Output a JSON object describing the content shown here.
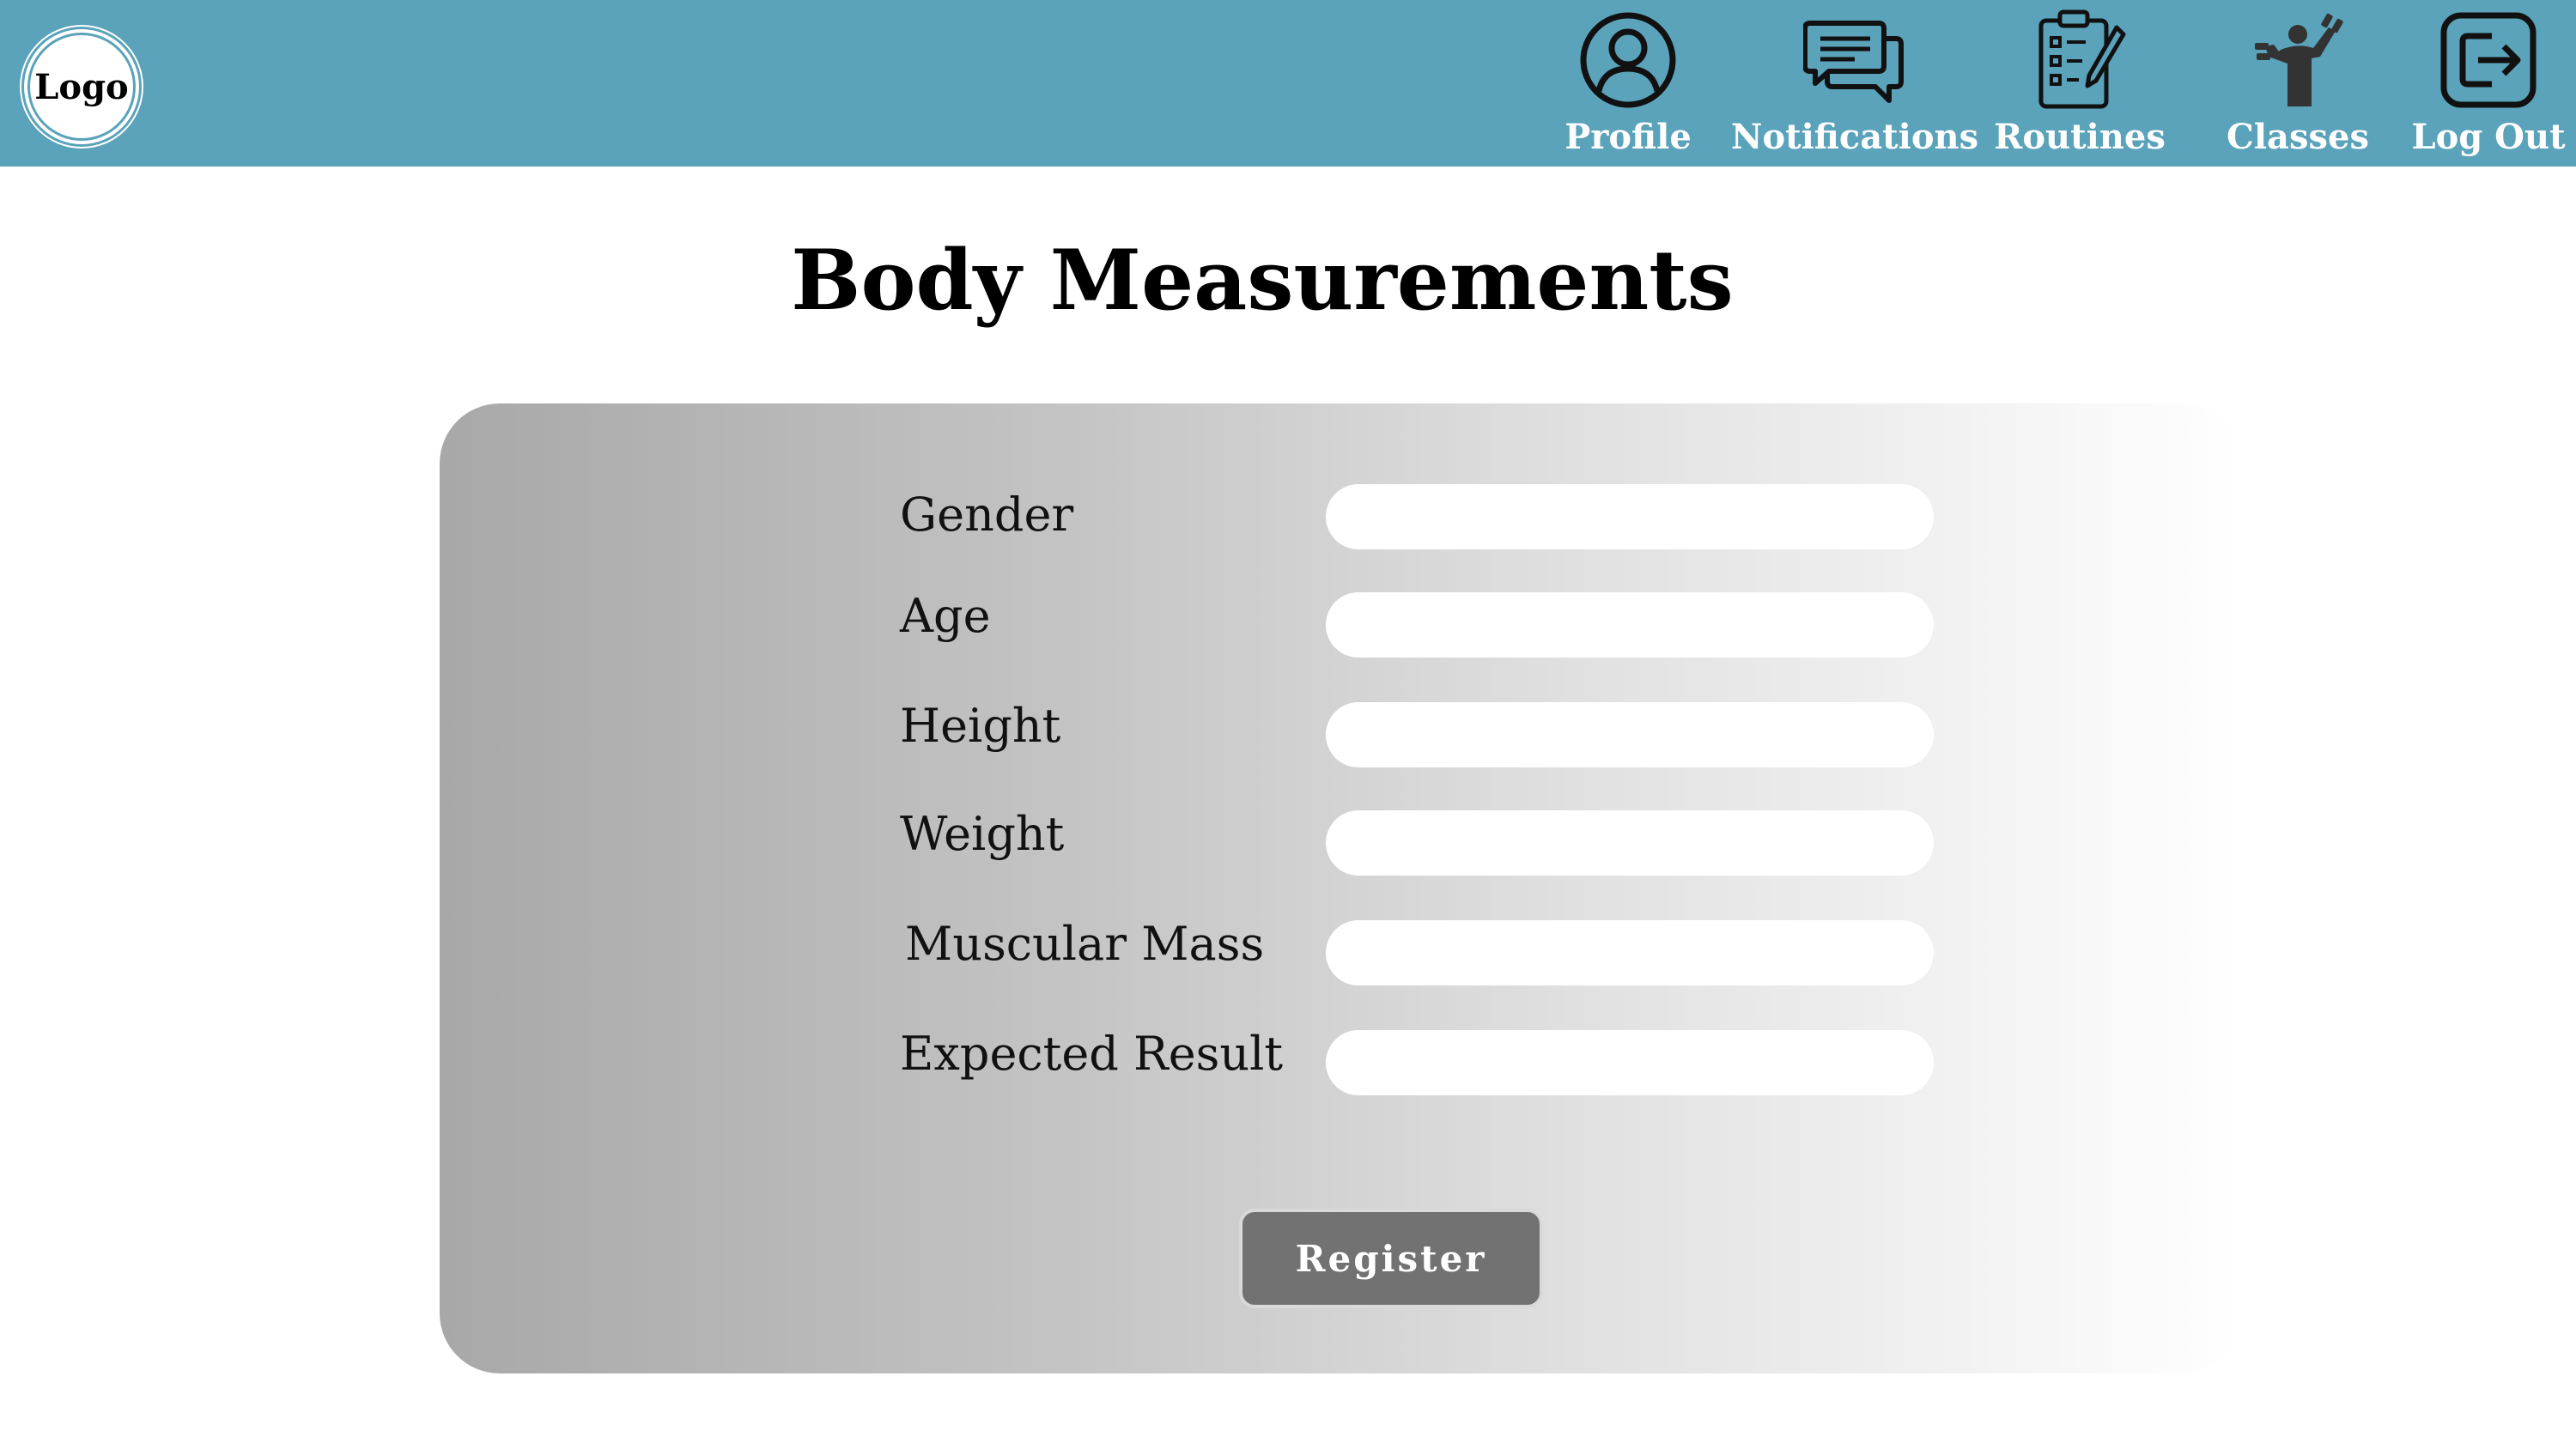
{
  "header": {
    "logo_text": "Logo",
    "bar_color": "#5aa3ba",
    "nav": [
      {
        "label": "Profile",
        "icon": "profile-icon"
      },
      {
        "label": "Notifications",
        "icon": "chat-bubbles-icon"
      },
      {
        "label": "Routines",
        "icon": "clipboard-checklist-icon"
      },
      {
        "label": "Classes",
        "icon": "weightlifter-icon"
      },
      {
        "label": "Log Out",
        "icon": "logout-icon"
      }
    ]
  },
  "main": {
    "title": "Body Measurements",
    "fields": [
      {
        "label": "Gender",
        "value": ""
      },
      {
        "label": "Age",
        "value": ""
      },
      {
        "label": "Height",
        "value": ""
      },
      {
        "label": "Weight",
        "value": ""
      },
      {
        "label": "Muscular Mass",
        "value": ""
      },
      {
        "label": "Expected Result",
        "value": ""
      }
    ],
    "register_label": "Register"
  }
}
